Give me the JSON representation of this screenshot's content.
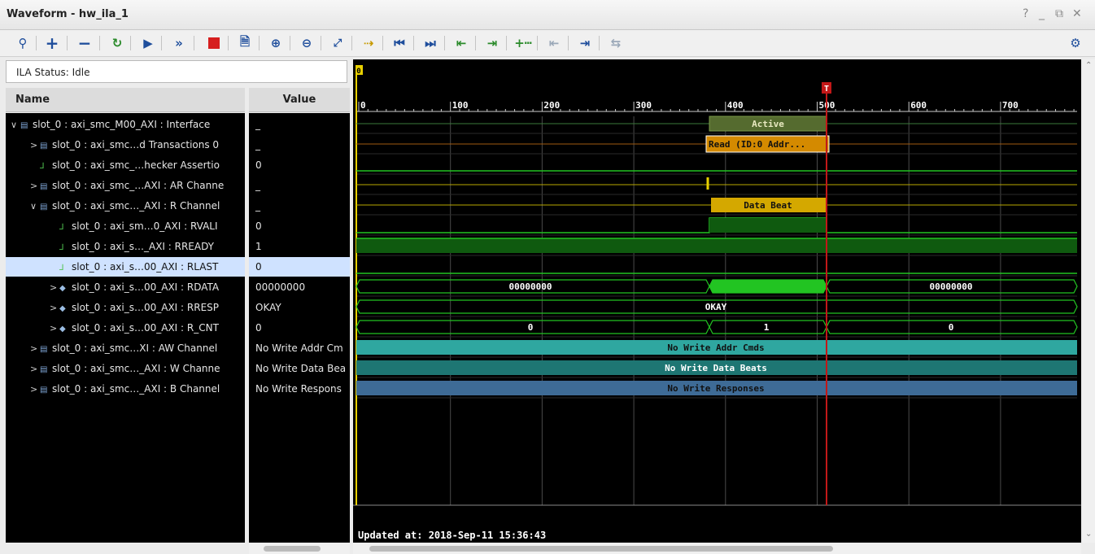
{
  "window": {
    "title": "Waveform - hw_ila_1",
    "help": "?",
    "minimize": "_",
    "restore": "⧉",
    "close": "✕"
  },
  "toolbar": {
    "icons": [
      "search-icon",
      "add-icon",
      "remove-icon",
      "refresh-icon",
      "run-trigger-icon",
      "run-immediate-icon",
      "stop-icon",
      "export-icon",
      "zoom-in-icon",
      "zoom-out-icon",
      "zoom-fit-icon",
      "go-to-cursor-icon",
      "go-to-time-zero-icon",
      "go-to-last-time-icon",
      "previous-transition-icon",
      "next-transition-icon",
      "add-marker-icon",
      "previous-marker-icon",
      "next-marker-icon",
      "swap-cursors-icon",
      "settings-icon"
    ]
  },
  "ila_status": "ILA Status: Idle",
  "columns": {
    "name": "Name",
    "value": "Value"
  },
  "signals": [
    {
      "name": "slot_0 : axi_smc_M00_AXI : Interface",
      "value": "_",
      "indent": 0,
      "arrow": "∨",
      "icon": "bus"
    },
    {
      "name": "slot_0 : axi_smc…d Transactions 0",
      "value": "_",
      "indent": 1,
      "arrow": ">",
      "icon": "bus"
    },
    {
      "name": "slot_0 : axi_smc_…hecker Assertio",
      "value": "0",
      "indent": 1,
      "arrow": "",
      "icon": "bit"
    },
    {
      "name": "slot_0 : axi_smc_…AXI : AR Channe",
      "value": "_",
      "indent": 1,
      "arrow": ">",
      "icon": "bus"
    },
    {
      "name": "slot_0 : axi_smc…_AXI : R Channel",
      "value": "_",
      "indent": 1,
      "arrow": "∨",
      "icon": "bus"
    },
    {
      "name": "slot_0 : axi_sm…0_AXI : RVALI",
      "value": "0",
      "indent": 2,
      "arrow": "",
      "icon": "bit"
    },
    {
      "name": "slot_0 : axi_s…_AXI : RREADY",
      "value": "1",
      "indent": 2,
      "arrow": "",
      "icon": "bit"
    },
    {
      "name": "slot_0 : axi_s…00_AXI : RLAST",
      "value": "0",
      "indent": 2,
      "arrow": "",
      "icon": "bit",
      "selected": true
    },
    {
      "name": "slot_0 : axi_s…00_AXI : RDATA",
      "value": "00000000",
      "indent": 2,
      "arrow": ">",
      "icon": "vec"
    },
    {
      "name": "slot_0 : axi_s…00_AXI : RRESP",
      "value": "OKAY",
      "indent": 2,
      "arrow": ">",
      "icon": "vec"
    },
    {
      "name": "slot_0 : axi_s…00_AXI : R_CNT",
      "value": "0",
      "indent": 2,
      "arrow": ">",
      "icon": "vec"
    },
    {
      "name": "slot_0 : axi_smc…XI : AW Channel",
      "value": "No Write Addr Cm",
      "indent": 1,
      "arrow": ">",
      "icon": "bus"
    },
    {
      "name": "slot_0 : axi_smc…_AXI : W Channe",
      "value": "No Write Data Bea",
      "indent": 1,
      "arrow": ">",
      "icon": "bus"
    },
    {
      "name": "slot_0 : axi_smc…_AXI : B Channel",
      "value": "No Write Respons",
      "indent": 1,
      "arrow": ">",
      "icon": "bus"
    }
  ],
  "timeline": {
    "ticks": [
      "0",
      "100",
      "200",
      "300",
      "400",
      "500",
      "600",
      "700"
    ],
    "marker_label": "0",
    "cursor_label": "T"
  },
  "waves": {
    "active": "Active",
    "read": "Read (ID:0 Addr...",
    "data_beat": "Data Beat",
    "rdata_before": "00000000",
    "rdata_after": "00000000",
    "rresp": "OKAY",
    "rcnt_before": "0",
    "rcnt_mid": "1",
    "rcnt_after": "0",
    "aw": "No Write Addr Cmds",
    "w": "No Write Data Beats",
    "b": "No Write Responses"
  },
  "updated_at": "Updated at: 2018-Sep-11 15:36:43",
  "colors": {
    "bg": "#000000",
    "grid": "#4a4a4a",
    "green": "#22c422",
    "yellow": "#e8d000",
    "orange": "#d48a00",
    "olive": "#556b2f",
    "cursor": "#c21818",
    "teal1": "#2fa7a0",
    "teal2": "#1e7673",
    "blue": "#3e6b96"
  }
}
